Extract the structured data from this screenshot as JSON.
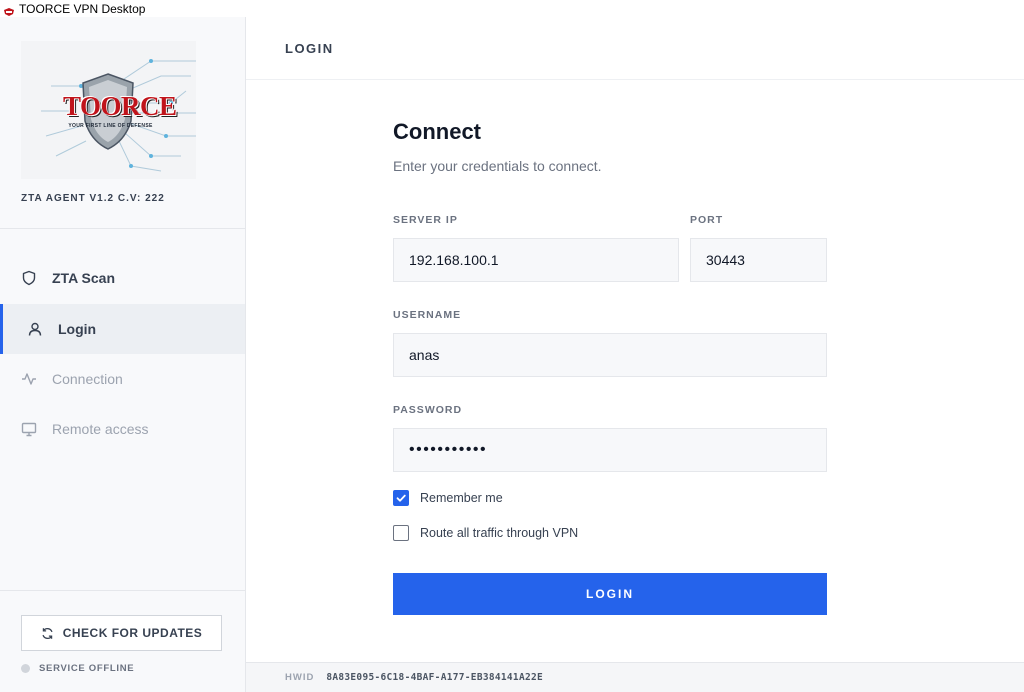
{
  "window": {
    "title": "TOORCE VPN Desktop",
    "icon": "app-icon"
  },
  "sidebar": {
    "logo": {
      "brand": "TOORCE",
      "tagline": "YOUR FIRST LINE OF DEFENSE"
    },
    "version": "ZTA AGENT V1.2 C.V: 222",
    "nav": [
      {
        "label": "ZTA Scan",
        "icon": "shield-icon",
        "state": "normal"
      },
      {
        "label": "Login",
        "icon": "user-icon",
        "state": "active"
      },
      {
        "label": "Connection",
        "icon": "activity-icon",
        "state": "disabled"
      },
      {
        "label": "Remote access",
        "icon": "monitor-icon",
        "state": "disabled"
      }
    ],
    "update_button": "CHECK FOR UPDATES",
    "service_status": "SERVICE OFFLINE"
  },
  "header": {
    "title": "LOGIN"
  },
  "form": {
    "title": "Connect",
    "subtitle": "Enter your credentials to connect.",
    "server_ip": {
      "label": "SERVER IP",
      "value": "192.168.100.1"
    },
    "port": {
      "label": "PORT",
      "value": "30443"
    },
    "username": {
      "label": "USERNAME",
      "value": "anas"
    },
    "password": {
      "label": "PASSWORD",
      "value": "•••••••••••"
    },
    "remember_me": {
      "label": "Remember me",
      "checked": true
    },
    "route_all": {
      "label": "Route all traffic through VPN",
      "checked": false
    },
    "submit": "LOGIN"
  },
  "footer": {
    "hwid_label": "HWID",
    "hwid_value": "8A83E095-6C18-4BAF-A177-EB384141A22E"
  },
  "colors": {
    "accent": "#2563eb",
    "brand_red": "#c0141b"
  }
}
